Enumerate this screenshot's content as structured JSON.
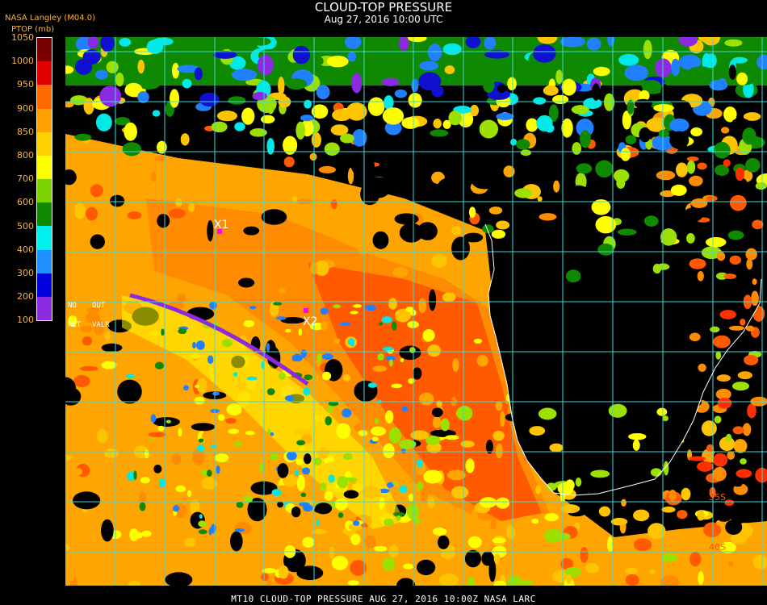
{
  "header": {
    "title": "CLOUD-TOP PRESSURE",
    "subtitle": "Aug 27, 2016 10:00 UTC",
    "source": "NASA Langley (M04.0)",
    "units": "PTOP (mb)"
  },
  "colorbar": {
    "ticks": [
      "1050",
      "1000",
      "950",
      "900",
      "850",
      "800",
      "700",
      "600",
      "500",
      "400",
      "300",
      "200",
      "100"
    ],
    "bands": [
      {
        "from": 1050,
        "to": 1000,
        "color": "#7a0000"
      },
      {
        "from": 1000,
        "to": 950,
        "color": "#e00000"
      },
      {
        "from": 950,
        "to": 900,
        "color": "#ff6a00"
      },
      {
        "from": 900,
        "to": 850,
        "color": "#ffa000"
      },
      {
        "from": 850,
        "to": 800,
        "color": "#ffd000"
      },
      {
        "from": 800,
        "to": 700,
        "color": "#ffff00"
      },
      {
        "from": 700,
        "to": 600,
        "color": "#7ad400"
      },
      {
        "from": 600,
        "to": 500,
        "color": "#108a00"
      },
      {
        "from": 500,
        "to": 400,
        "color": "#00f0f0"
      },
      {
        "from": 400,
        "to": 300,
        "color": "#1e90ff"
      },
      {
        "from": 300,
        "to": 200,
        "color": "#0000dd"
      },
      {
        "from": 200,
        "to": 100,
        "color": "#8a2be2"
      }
    ]
  },
  "legend_flags": {
    "no": "NO",
    "out": "OUT",
    "ret": "RET",
    "valr": "VALR"
  },
  "markers": [
    {
      "label": "X1"
    },
    {
      "label": "X2"
    }
  ],
  "latitude_labels": [
    "35S",
    "40S"
  ],
  "footer": "MT10  CLOUD-TOP PRESSURE  AUG 27, 2016 10:00Z  NASA LARC",
  "colors": {
    "grid": "#3fd8d8",
    "marker": "#ff00ff",
    "coast": "#ffffff",
    "lat_label": "#ff5a00"
  }
}
